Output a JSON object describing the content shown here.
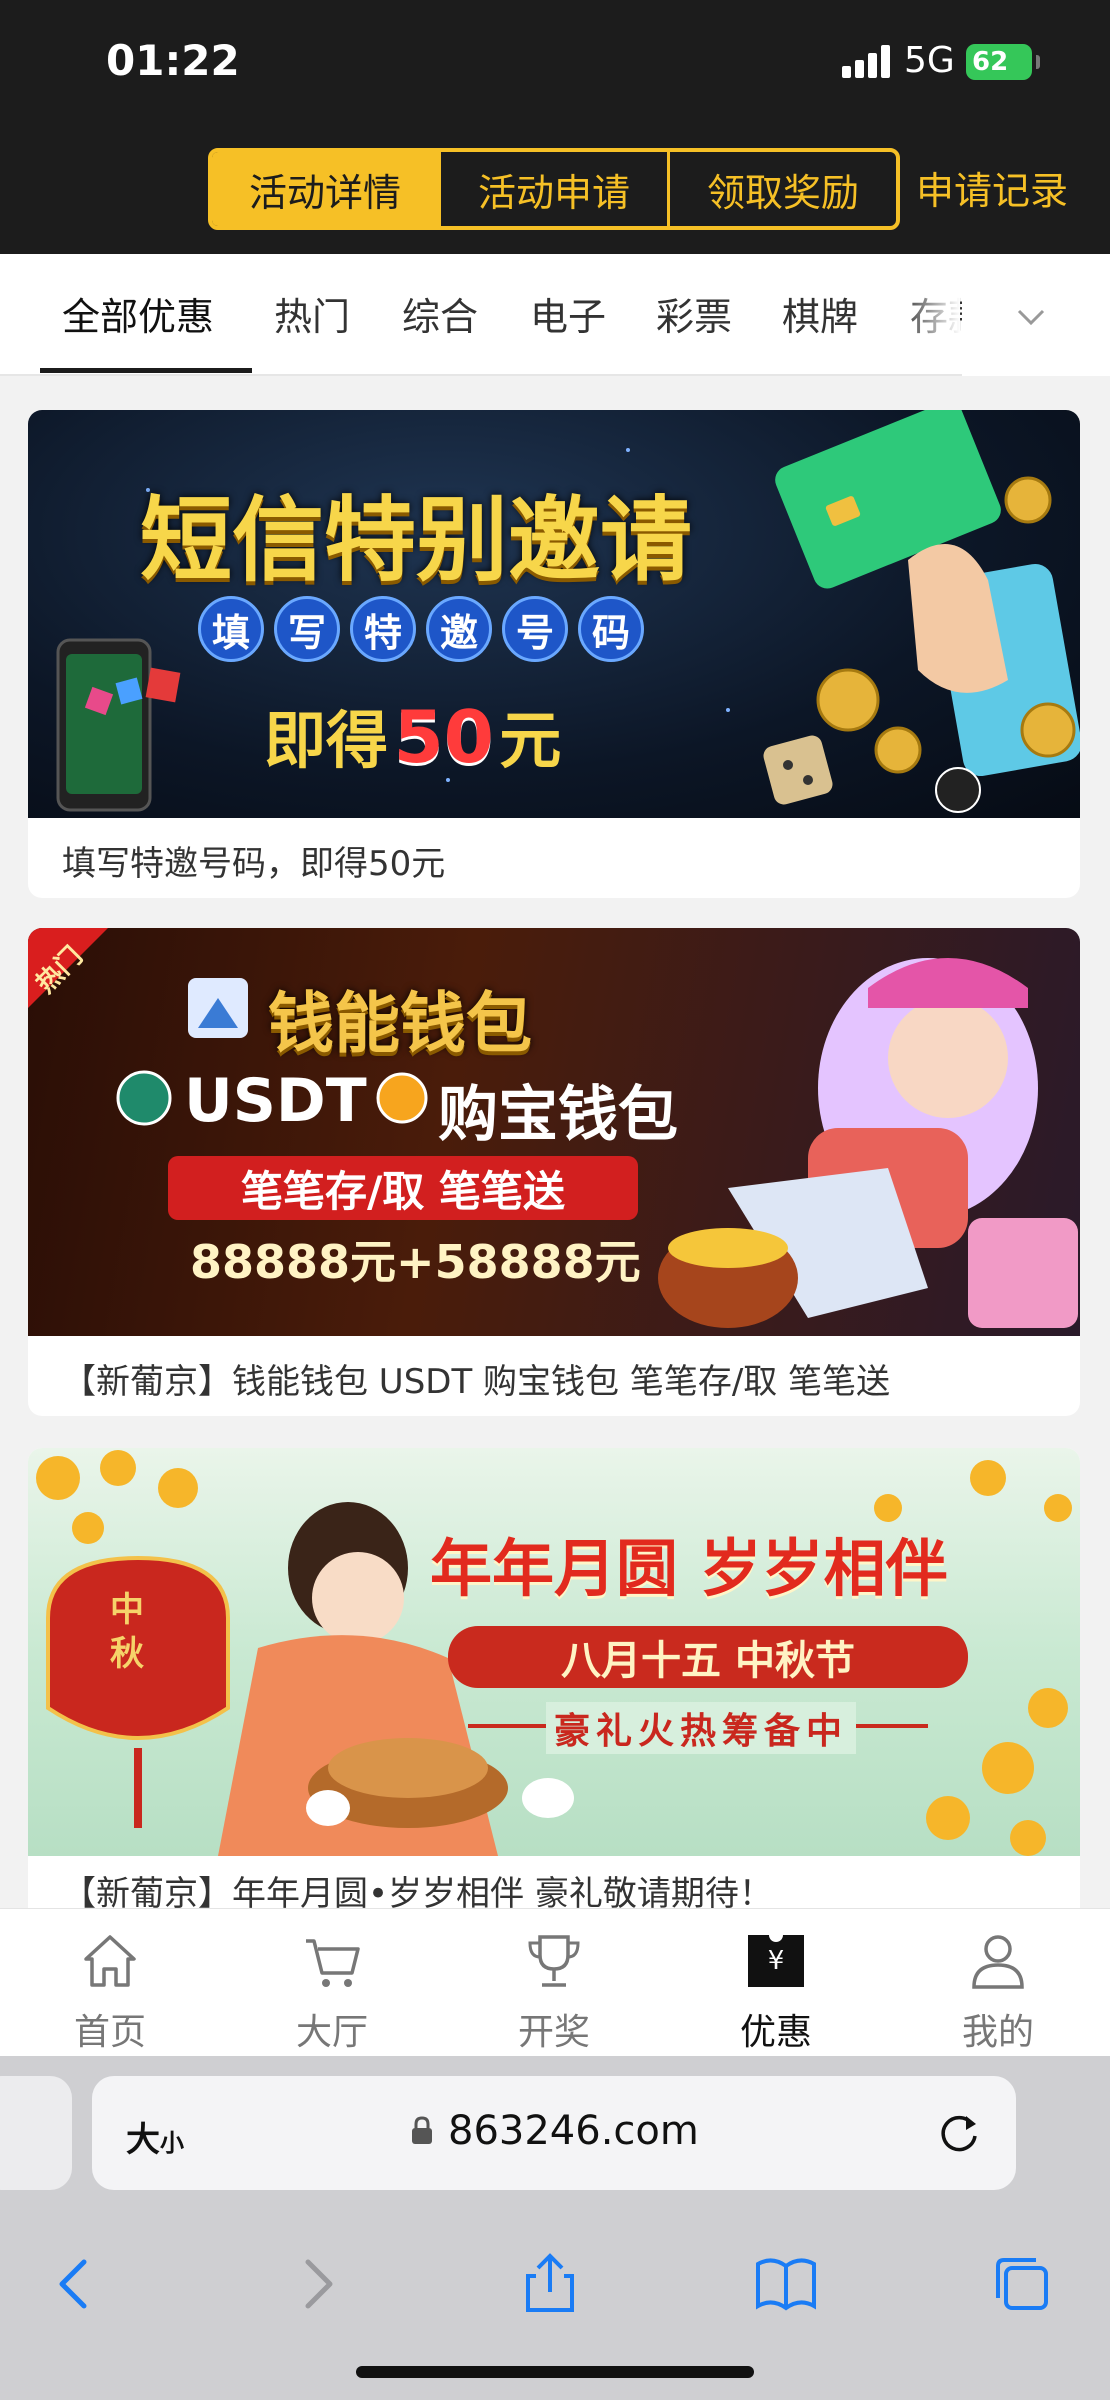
{
  "status": {
    "time": "01:22",
    "network": "5G",
    "battery": "62"
  },
  "header": {
    "segments": [
      "活动详情",
      "活动申请",
      "领取奖励"
    ],
    "active_segment": 0,
    "record_link": "申请记录"
  },
  "categories": {
    "items": [
      "全部优惠",
      "热门",
      "综合",
      "电子",
      "彩票",
      "棋牌",
      "存款"
    ],
    "active": 0
  },
  "promos": [
    {
      "banner_title": "短信特别邀请",
      "banner_pills": [
        "填",
        "写",
        "特",
        "邀",
        "号",
        "码"
      ],
      "banner_line_prefix": "即得",
      "banner_amount": "50",
      "banner_line_suffix": "元",
      "caption": "填写特邀号码，即得50元"
    },
    {
      "hot_tag": "热门",
      "banner_brand": "钱能钱包",
      "banner_line1": "USDT",
      "banner_line1b": "购宝钱包",
      "banner_line2": "笔笔存/取  笔笔送",
      "banner_line3": "88888元+58888元",
      "caption": "【新葡京】钱能钱包 USDT 购宝钱包 笔笔存/取 笔笔送"
    },
    {
      "banner_title": "年年月圆 岁岁相伴",
      "banner_line2": "八月十五  中秋节",
      "banner_line3": "豪礼火热筹备中",
      "lantern_text": "中秋",
      "caption": "【新葡京】年年月圆•岁岁相伴 豪礼敬请期待！"
    }
  ],
  "tabbar": {
    "items": [
      {
        "label": "首页",
        "icon": "home-icon"
      },
      {
        "label": "大厅",
        "icon": "cart-icon"
      },
      {
        "label": "开奖",
        "icon": "trophy-icon"
      },
      {
        "label": "优惠",
        "icon": "coupon-icon"
      },
      {
        "label": "我的",
        "icon": "person-icon"
      }
    ],
    "active": 3
  },
  "browser": {
    "text_size_label": "大",
    "text_size_small": "小",
    "url": "863246.com"
  },
  "colors": {
    "accent": "#f6c026",
    "header_bg": "#1c1c1c"
  }
}
